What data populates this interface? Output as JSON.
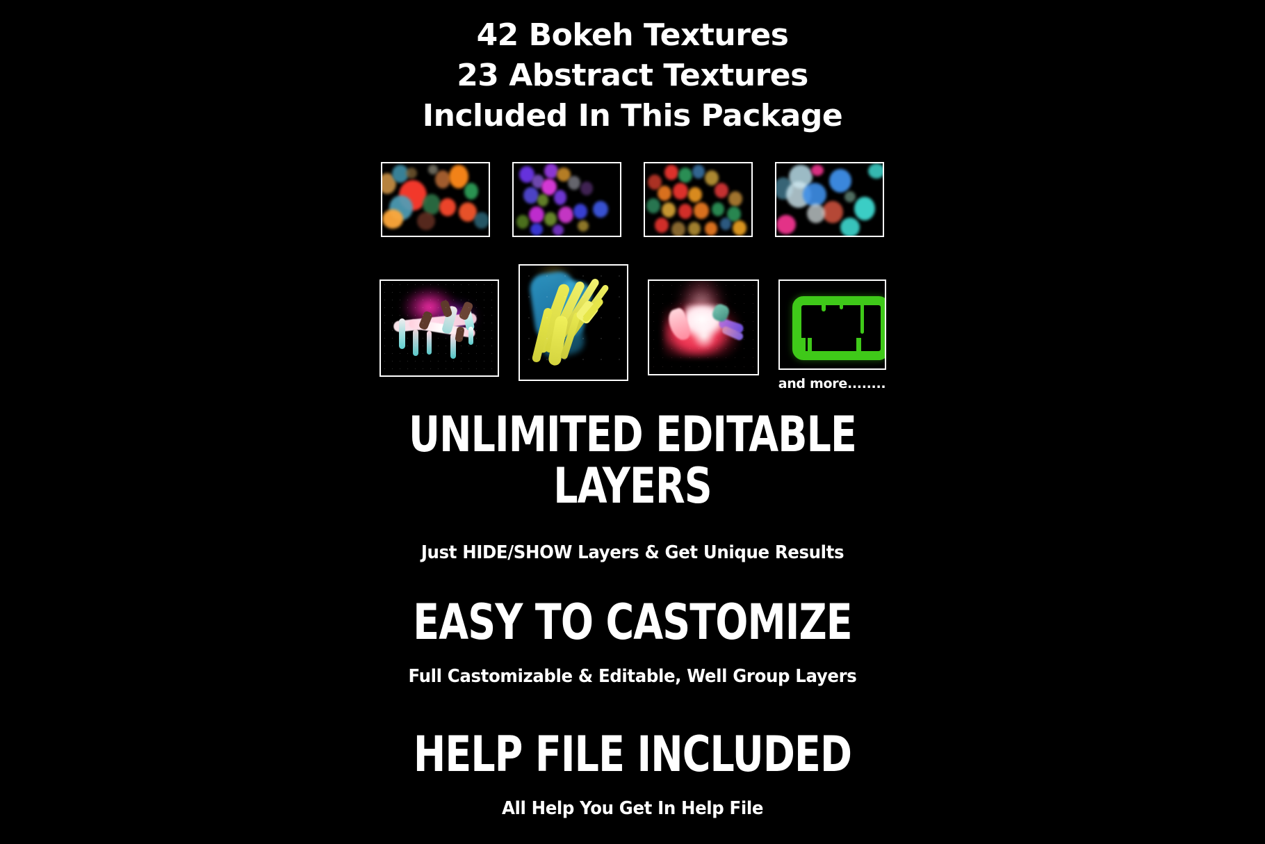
{
  "background_color": "#000000",
  "text_color": "#ffffff",
  "headline": {
    "line1": "42 Bokeh Textures",
    "line2": "23 Abstract Textures",
    "line3": "Included In This Package"
  },
  "bokeh_thumbnails": [
    {
      "name": "bokeh-thumb-warm-red",
      "palette": [
        "#ff3b2e",
        "#ff7a1a",
        "#3f9fbf",
        "#2fa25a",
        "#c98b3a"
      ]
    },
    {
      "name": "bokeh-thumb-violet",
      "palette": [
        "#7b3cf0",
        "#b93ce8",
        "#3f46e8",
        "#8fd13a",
        "#c8a33a"
      ]
    },
    {
      "name": "bokeh-thumb-multicolor",
      "palette": [
        "#e8342e",
        "#f07d22",
        "#2f9e5e",
        "#e8c03a",
        "#3f7fb5"
      ]
    },
    {
      "name": "bokeh-thumb-cyan-pink",
      "palette": [
        "#3fd9d0",
        "#3f8fe8",
        "#b8dce8",
        "#c9503c",
        "#f0358f"
      ]
    }
  ],
  "abstract_thumbnails": [
    {
      "name": "abstract-thumb-pink-drip",
      "palette": [
        "#ff2fb0",
        "#57e8dd",
        "#f2d9d9",
        "#6b4436"
      ]
    },
    {
      "name": "abstract-thumb-yellow-blue-strokes",
      "palette": [
        "#e8e84a",
        "#3fa8d9",
        "#1a6f9e",
        "#000000"
      ]
    },
    {
      "name": "abstract-thumb-pink-splash",
      "palette": [
        "#ff4d5e",
        "#ffffff",
        "#7a4fd9",
        "#ff9fb0"
      ]
    },
    {
      "name": "abstract-thumb-green-frame",
      "palette": [
        "#3fc919",
        "#2aa80f",
        "#000000"
      ]
    }
  ],
  "and_more_label": "and more........",
  "features": [
    {
      "name": "feature-unlimited-layers",
      "title_line1": "UNLIMITED EDITABLE",
      "title_line2": "LAYERS",
      "subtitle": "Just HIDE/SHOW Layers & Get Unique Results"
    },
    {
      "name": "feature-easy-customize",
      "title_line1": "EASY TO CASTOMIZE",
      "title_line2": "",
      "subtitle": "Full Castomizable & Editable, Well Group Layers"
    },
    {
      "name": "feature-help-file",
      "title_line1": "HELP FILE INCLUDED",
      "title_line2": "",
      "subtitle": "All Help You Get In Help File"
    }
  ]
}
